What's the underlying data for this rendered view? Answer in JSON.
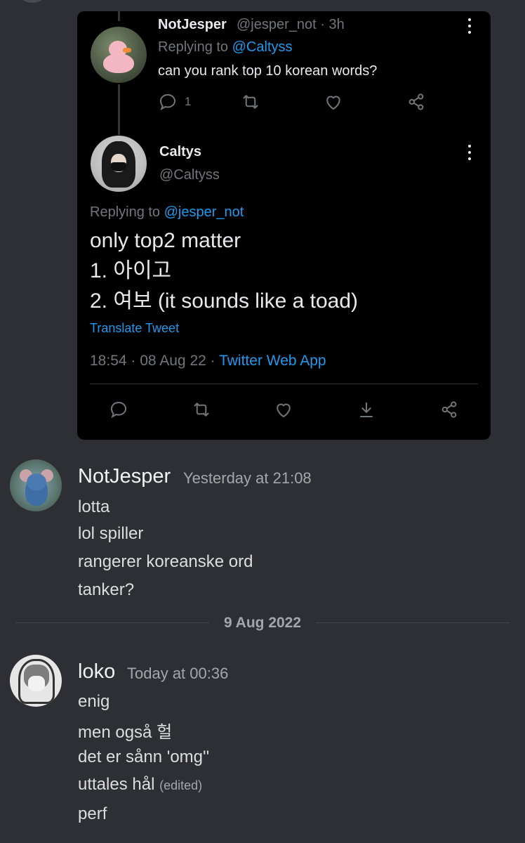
{
  "tweet": {
    "parent": {
      "name": "NotJesper",
      "handle_time": "@jesper_not · 3h",
      "replying_prefix": "Replying to ",
      "replying_to": "@Caltyss",
      "text": "can you rank top 10 korean words?",
      "reply_count": "1"
    },
    "main": {
      "name": "Caltys",
      "handle": "@Caltyss",
      "replying_prefix": "Replying to ",
      "replying_to": "@jesper_not",
      "lines": [
        "only top2 matter",
        "1. 아이고",
        "2. 여보 (it sounds like a toad)"
      ],
      "translate_label": "Translate Tweet",
      "timestamp": "18:54 · 08 Aug 22 · ",
      "source": "Twitter Web App"
    },
    "colors": {
      "link": "#1d9bf0",
      "background": "#000000"
    }
  },
  "messages": [
    {
      "author": "NotJesper",
      "time": "Yesterday at 21:08",
      "lines": [
        "lotta",
        "lol spiller",
        "rangerer koreanske ord",
        "tanker?"
      ]
    },
    {
      "author": "loko",
      "time": "Today at 00:36",
      "lines": [
        "enig",
        "men også 헐",
        "det er sånn 'omg''",
        "uttales hål",
        "perf"
      ],
      "edited_label": "(edited)"
    }
  ],
  "date_separator": "9 Aug 2022",
  "icons": [
    "reply-icon",
    "retweet-icon",
    "like-icon",
    "download-icon",
    "share-icon",
    "more-icon"
  ]
}
